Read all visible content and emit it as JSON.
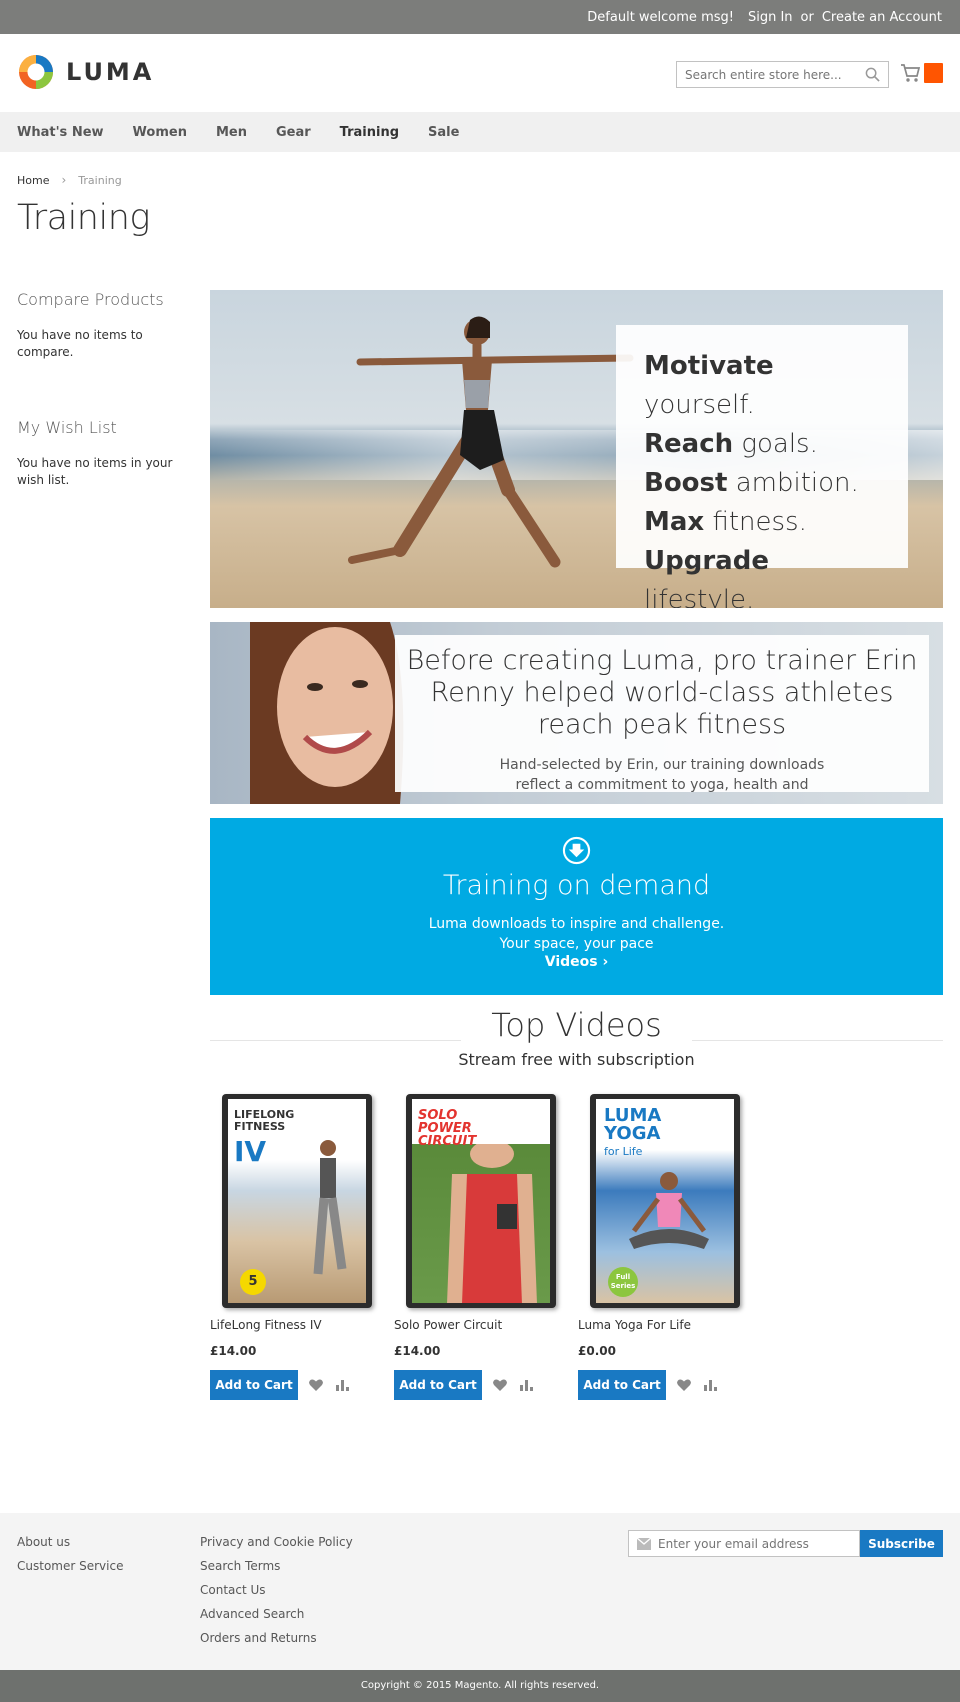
{
  "topbar": {
    "welcome": "Default welcome msg!",
    "sign_in": "Sign In",
    "or": "or",
    "create_account": "Create an Account"
  },
  "header": {
    "logo_text": "LUMA",
    "search_placeholder": "Search entire store here...",
    "accent": "#ff5501"
  },
  "nav": {
    "items": [
      {
        "label": "What's New"
      },
      {
        "label": "Women"
      },
      {
        "label": "Men"
      },
      {
        "label": "Gear"
      },
      {
        "label": "Training",
        "active": true
      },
      {
        "label": "Sale"
      }
    ]
  },
  "breadcrumb": {
    "home": "Home",
    "current": "Training"
  },
  "page_title": "Training",
  "sidebar": {
    "compare_title": "Compare Products",
    "compare_empty": "You have no items to compare.",
    "wishlist_title": "My Wish List",
    "wishlist_empty": "You have no items in your wish list."
  },
  "hero1": {
    "lines": [
      {
        "bold": "Motivate",
        "rest": " yourself."
      },
      {
        "bold": "Reach",
        "rest": " goals."
      },
      {
        "bold": "Boost",
        "rest": " ambition."
      },
      {
        "bold": "Max",
        "rest": " fitness."
      },
      {
        "bold": "Upgrade",
        "rest": " lifestyle."
      }
    ]
  },
  "hero2": {
    "headline": "Before creating Luma, pro trainer Erin Renny helped world-class athletes reach peak fitness",
    "sub": "Hand-selected by Erin, our training downloads reflect a commitment to yoga, health and wellness."
  },
  "demand": {
    "title": "Training on demand",
    "line1": "Luma downloads to inspire and challenge.",
    "line2": "Your space, your pace",
    "link": "Videos",
    "color": "#00aae3"
  },
  "top_videos": {
    "title": "Top Videos",
    "subtitle": "Stream free with subscription"
  },
  "products": [
    {
      "name": "LifeLong Fitness IV",
      "price": "£14.00",
      "add": "Add to Cart",
      "cover_title": "LIFELONG FITNESS",
      "cover_sub": "IV",
      "badge": "5"
    },
    {
      "name": "Solo Power Circuit",
      "price": "£14.00",
      "add": "Add to Cart",
      "cover_title": "SOLO POWER CIRCUIT",
      "cover_sub": "",
      "badge": ""
    },
    {
      "name": "Luma Yoga For Life",
      "price": "£0.00",
      "add": "Add to Cart",
      "cover_title": "LUMA YOGA",
      "cover_sub": "for Life",
      "badge": "Full Series"
    }
  ],
  "footer": {
    "col1": [
      "About us",
      "Customer Service"
    ],
    "col2": [
      "Privacy and Cookie Policy",
      "Search Terms",
      "Contact Us",
      "Advanced Search",
      "Orders and Returns"
    ],
    "newsletter_placeholder": "Enter your email address",
    "subscribe": "Subscribe",
    "copyright": "Copyright © 2015 Magento. All rights reserved."
  }
}
